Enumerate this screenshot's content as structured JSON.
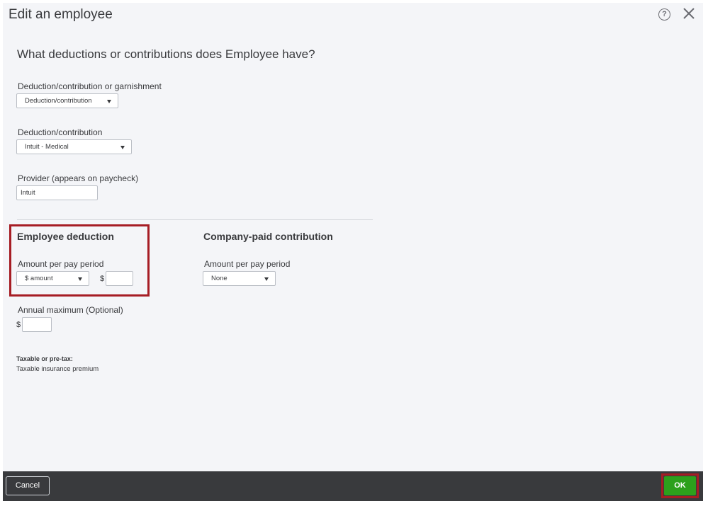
{
  "dialog": {
    "title": "Edit an employee",
    "help_icon": "question-circle-icon",
    "close_icon": "close-x-icon"
  },
  "form": {
    "heading": "What deductions or contributions does Employee have?",
    "type_label": "Deduction/contribution or garnishment",
    "type_value": "Deduction/contribution",
    "deduction_label": "Deduction/contribution",
    "deduction_value": "Intuit - Medical",
    "provider_label": "Provider (appears on paycheck)",
    "provider_value": "Intuit"
  },
  "employee_deduction": {
    "title": "Employee deduction",
    "amount_label": "Amount per pay period",
    "amount_type": "$ amount",
    "currency": "$",
    "amount_value": "",
    "annual_label": "Annual maximum  (Optional)",
    "annual_currency": "$",
    "annual_value": ""
  },
  "company_contribution": {
    "title": "Company-paid contribution",
    "amount_label": "Amount per pay period",
    "amount_type": "None"
  },
  "tax": {
    "label": "Taxable or pre-tax:",
    "value": "Taxable insurance premium"
  },
  "footer": {
    "cancel_label": "Cancel",
    "ok_label": "OK"
  },
  "colors": {
    "highlight": "#a61d24",
    "ok_green": "#2ca01c",
    "footer_bg": "#393a3d"
  }
}
